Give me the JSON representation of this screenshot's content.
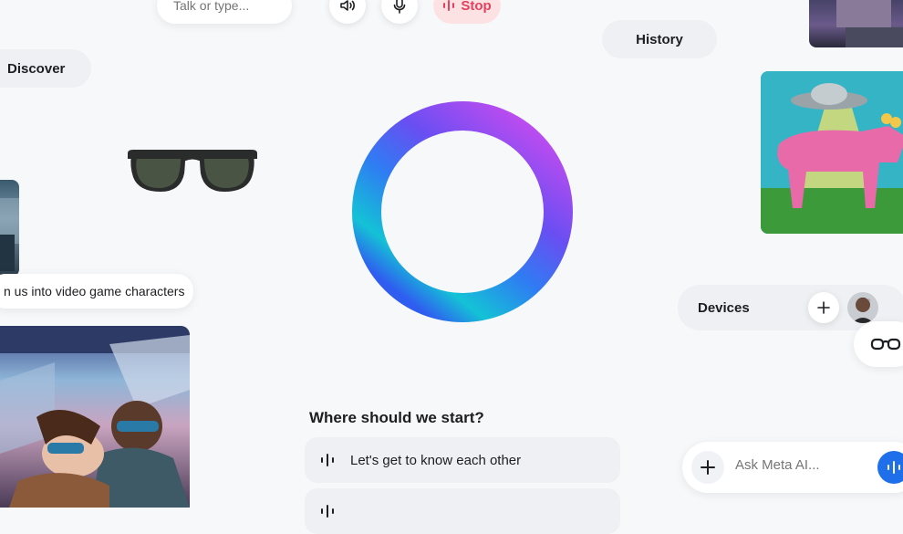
{
  "top_bar": {
    "input_placeholder": "Talk or type...",
    "speaker_icon": "speaker-icon",
    "mic_icon": "mic-icon",
    "stop_label": "Stop"
  },
  "discover_label": "Discover",
  "history_label": "History",
  "caption": "n us into video game characters",
  "devices": {
    "label": "Devices",
    "add_icon": "plus-icon"
  },
  "prompt_heading": "Where should we start?",
  "suggestions": [
    "Let's get to know each other"
  ],
  "composer": {
    "placeholder": "Ask Meta AI..."
  },
  "colors": {
    "stop_bg": "#fde2e4",
    "stop_fg": "#e4405f",
    "accent_blue": "#1f6feb"
  }
}
